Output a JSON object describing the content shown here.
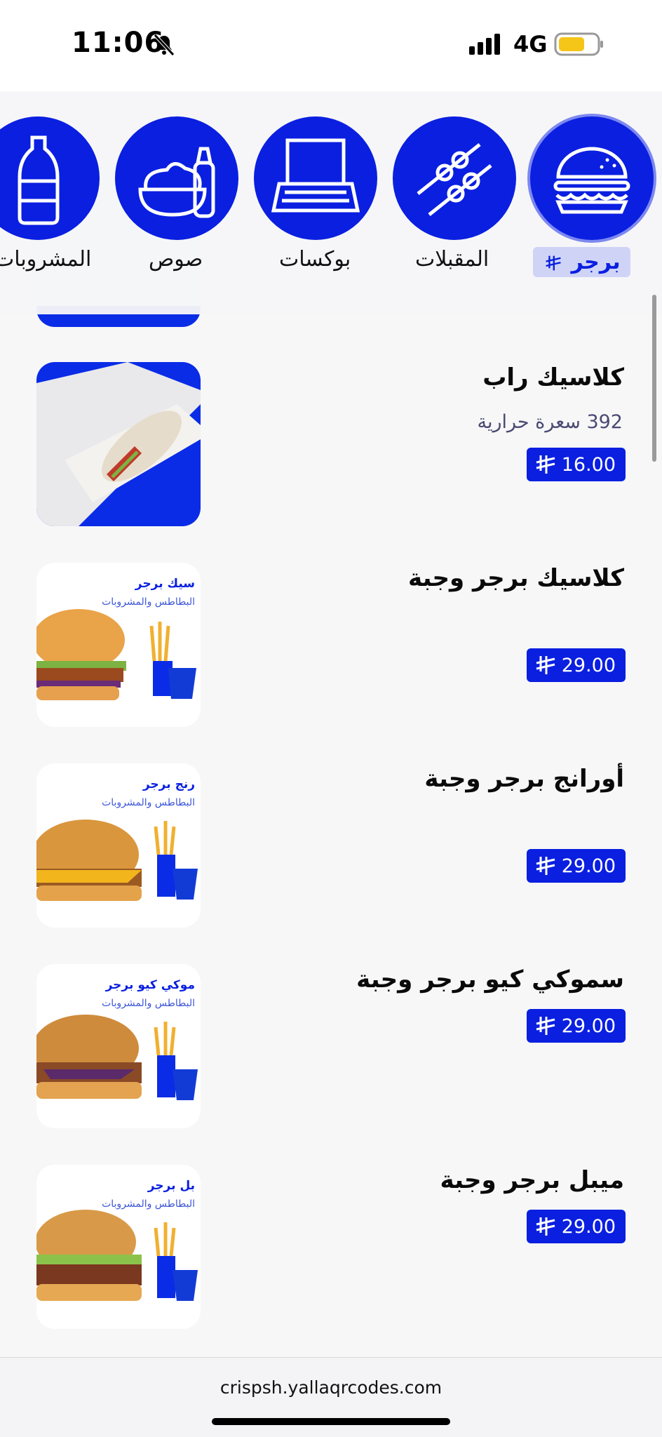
{
  "status": {
    "time": "11:06",
    "network": "4G"
  },
  "categories": [
    {
      "label": "برجر",
      "icon": "burger-icon",
      "active": true
    },
    {
      "label": "المقبلات",
      "icon": "skewers-icon",
      "active": false
    },
    {
      "label": "بوكسات",
      "icon": "box-icon",
      "active": false
    },
    {
      "label": "صوص",
      "icon": "sauce-icon",
      "active": false
    },
    {
      "label": "المشروبات",
      "icon": "drink-bottle-icon",
      "active": false
    }
  ],
  "items": [
    {
      "title": "كلاسيك راب",
      "calories": "392 سعرة حرارية",
      "price": "16.00"
    },
    {
      "title": "كلاسيك برجر وجبة",
      "price": "29.00",
      "img_caption": "سيك برجر",
      "img_sub": "البطاطس والمشروبات"
    },
    {
      "title": "أورانج برجر وجبة",
      "price": "29.00",
      "img_caption": "رنج برجر",
      "img_sub": "البطاطس والمشروبات"
    },
    {
      "title": "سموكي كيو برجر وجبة",
      "price": "29.00",
      "img_caption": "موكي كيو برجر",
      "img_sub": "البطاطس والمشروبات"
    },
    {
      "title": "ميبل برجر وجبة",
      "price": "29.00",
      "img_caption": "بل برجر",
      "img_sub": "البطاطس والمشروبات"
    }
  ],
  "footer": {
    "url": "crispsh.yallaqrcodes.com"
  },
  "colors": {
    "brand_blue": "#0a1fe0"
  }
}
